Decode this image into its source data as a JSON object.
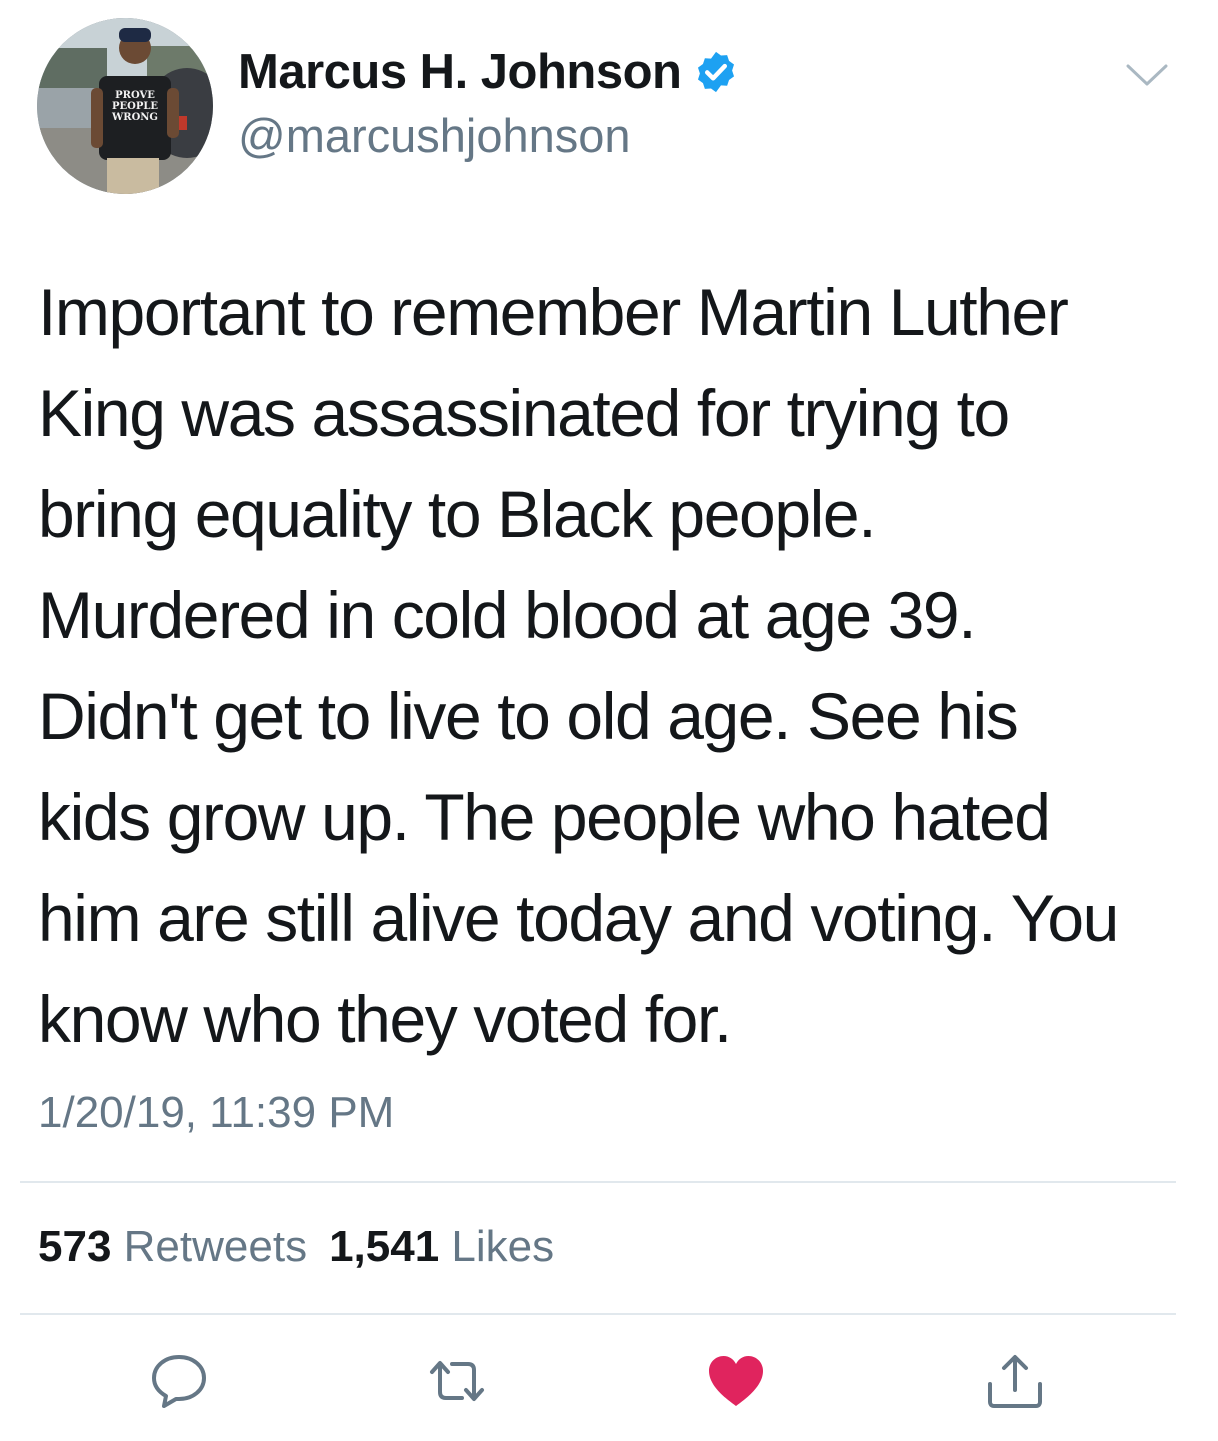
{
  "colors": {
    "text_primary": "#14171a",
    "text_secondary": "#657786",
    "verified_blue": "#1da1f2",
    "like_active": "#e0245e",
    "divider": "#e1e8ed"
  },
  "author": {
    "display_name": "Marcus H. Johnson",
    "handle": "@marcushjohnson",
    "verified": true,
    "avatar_icon": "profile-photo",
    "avatar_shirt_text": [
      "PROVE",
      "PEOPLE",
      "WRONG"
    ]
  },
  "tweet": {
    "text": "Important to remember Martin Luther\nKing was assassinated for trying to\nbring equality to Black people.\nMurdered in cold blood at age 39.\nDidn't get to live to old age. See his\nkids grow up. The people who hated\nhim are still alive today and voting. You\nknow who they voted for.",
    "timestamp": "1/20/19, 11:39 PM"
  },
  "stats": {
    "retweets_count": "573",
    "retweets_label": "Retweets",
    "likes_count": "1,541",
    "likes_label": "Likes"
  },
  "actions": [
    {
      "name": "reply",
      "icon": "reply-icon"
    },
    {
      "name": "retweet",
      "icon": "retweet-icon"
    },
    {
      "name": "like",
      "icon": "heart-icon",
      "active": true
    },
    {
      "name": "share",
      "icon": "share-icon"
    }
  ]
}
